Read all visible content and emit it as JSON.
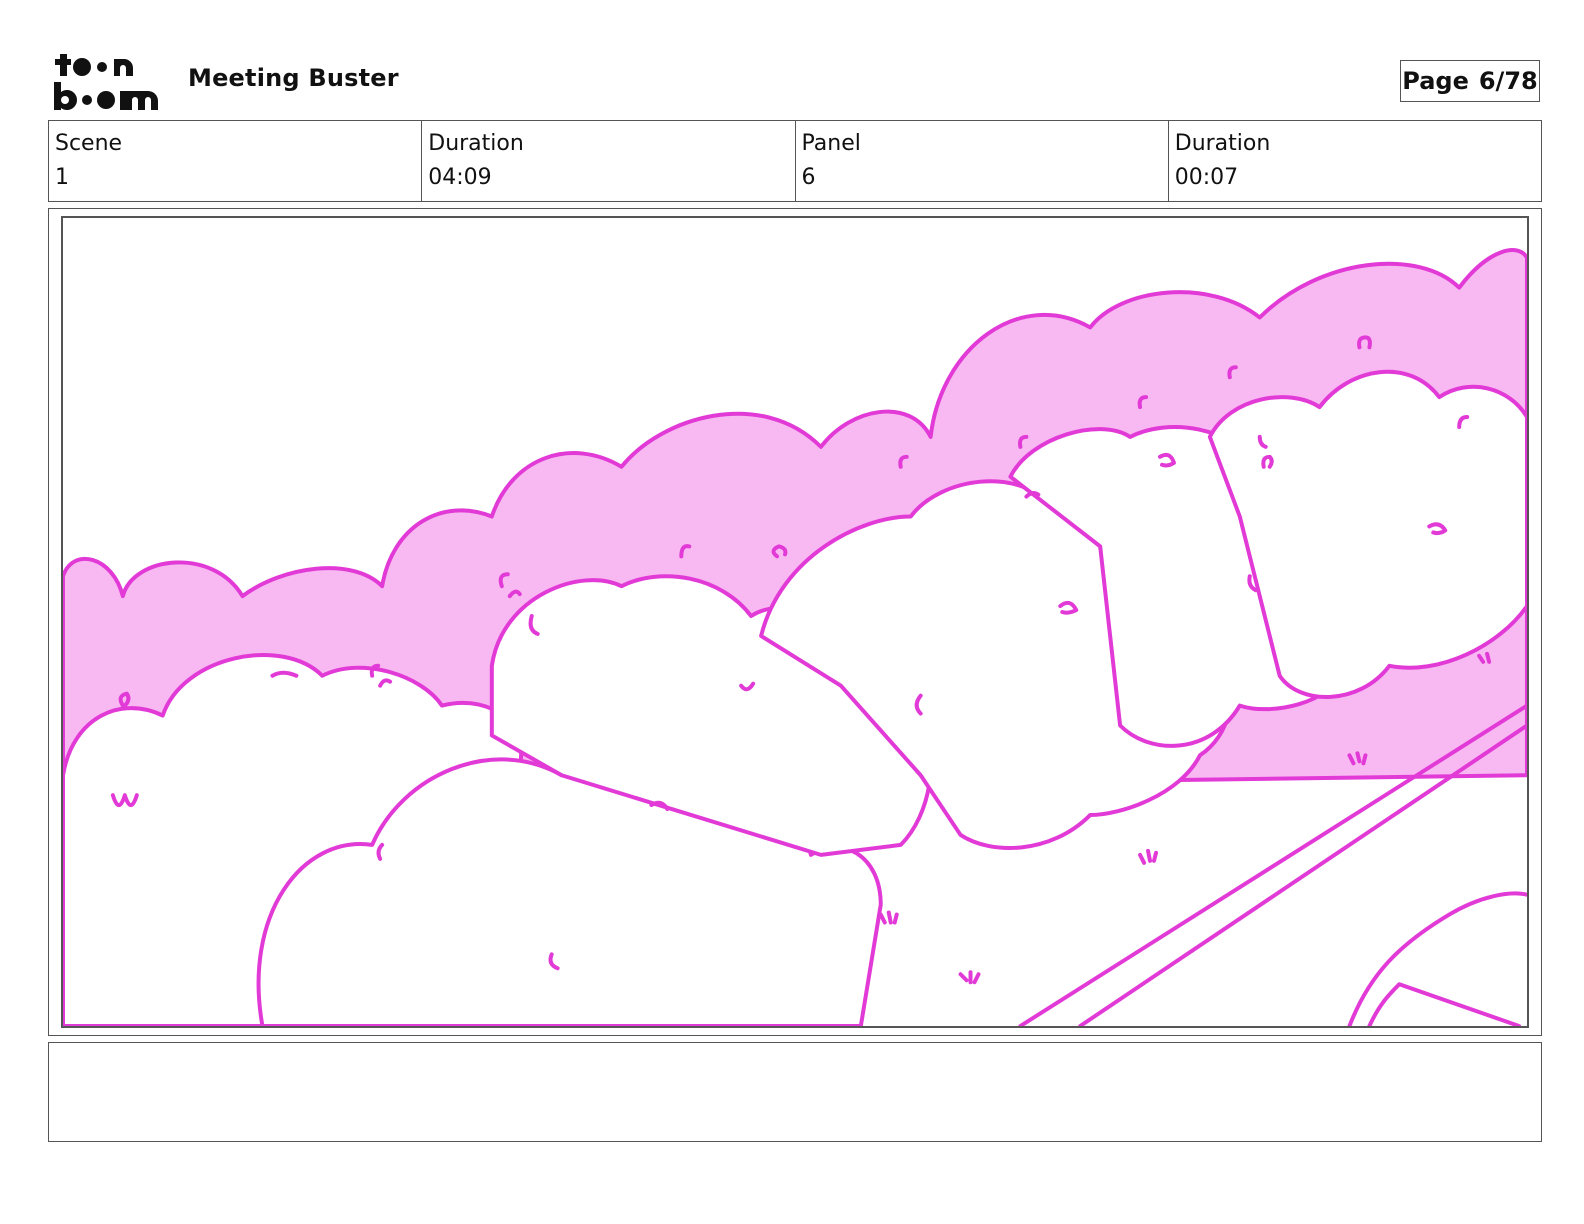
{
  "header": {
    "logo_text": "toonboom",
    "project_title": "Meeting Buster",
    "page_label": "Page",
    "page_number": "6/78"
  },
  "info": {
    "scene_label": "Scene",
    "scene_value": "1",
    "scene_duration_label": "Duration",
    "scene_duration_value": "04:09",
    "panel_label": "Panel",
    "panel_value": "6",
    "panel_duration_label": "Duration",
    "panel_duration_value": "00:07"
  },
  "panel_image": {
    "line_color": "#e23ad6",
    "fill_color": "#f8b8f2",
    "background": "#ffffff"
  },
  "notes": {
    "text": ""
  }
}
